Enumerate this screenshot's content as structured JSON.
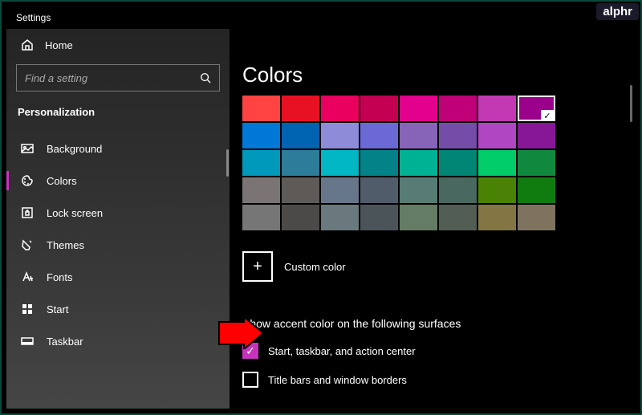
{
  "watermark": "alphr",
  "window": {
    "title": "Settings"
  },
  "sidebar": {
    "home_label": "Home",
    "search_placeholder": "Find a setting",
    "section_title": "Personalization",
    "items": [
      {
        "label": "Background",
        "icon": "picture-icon"
      },
      {
        "label": "Colors",
        "icon": "palette-icon",
        "active": true
      },
      {
        "label": "Lock screen",
        "icon": "lockscreen-icon"
      },
      {
        "label": "Themes",
        "icon": "themes-icon"
      },
      {
        "label": "Fonts",
        "icon": "fonts-icon"
      },
      {
        "label": "Start",
        "icon": "start-icon"
      },
      {
        "label": "Taskbar",
        "icon": "taskbar-icon"
      }
    ]
  },
  "main": {
    "heading": "Colors",
    "palette": [
      [
        {
          "c": "#ff4343"
        },
        {
          "c": "#e81123"
        },
        {
          "c": "#ea005e"
        },
        {
          "c": "#c30052"
        },
        {
          "c": "#e3008c"
        },
        {
          "c": "#bf0077"
        },
        {
          "c": "#c239b3"
        },
        {
          "c": "#9a0089",
          "selected": true
        }
      ],
      [
        {
          "c": "#0078d7"
        },
        {
          "c": "#0063b1"
        },
        {
          "c": "#8e8cd8"
        },
        {
          "c": "#6b69d6"
        },
        {
          "c": "#8764b8"
        },
        {
          "c": "#744da9"
        },
        {
          "c": "#b146c2"
        },
        {
          "c": "#881798"
        }
      ],
      [
        {
          "c": "#0099bc"
        },
        {
          "c": "#2d7d9a"
        },
        {
          "c": "#00b7c3"
        },
        {
          "c": "#038387"
        },
        {
          "c": "#00b294"
        },
        {
          "c": "#018574"
        },
        {
          "c": "#00cc6a"
        },
        {
          "c": "#10893e"
        }
      ],
      [
        {
          "c": "#7a7574"
        },
        {
          "c": "#5d5a58"
        },
        {
          "c": "#68768a"
        },
        {
          "c": "#515c6b"
        },
        {
          "c": "#567c73"
        },
        {
          "c": "#486860"
        },
        {
          "c": "#498205"
        },
        {
          "c": "#107c10"
        }
      ],
      [
        {
          "c": "#767676"
        },
        {
          "c": "#4c4a48"
        },
        {
          "c": "#69797e"
        },
        {
          "c": "#4a5459"
        },
        {
          "c": "#647c64"
        },
        {
          "c": "#525e54"
        },
        {
          "c": "#847545"
        },
        {
          "c": "#7e735f"
        }
      ]
    ],
    "custom_color_label": "Custom color",
    "surfaces_heading": "Show accent color on the following surfaces",
    "checks": [
      {
        "label": "Start, taskbar, and action center",
        "checked": true
      },
      {
        "label": "Title bars and window borders",
        "checked": false
      }
    ]
  }
}
